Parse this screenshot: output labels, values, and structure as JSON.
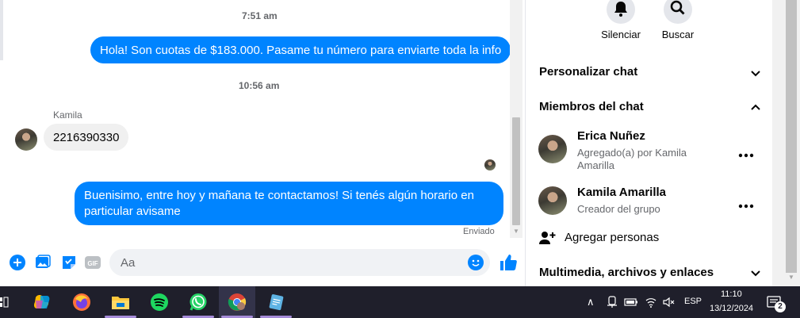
{
  "chat": {
    "timestamp1": "7:51 am",
    "message1": "Hola! Son cuotas de $183.000. Pasame tu número para enviarte toda la info",
    "timestamp2": "10:56 am",
    "sender_name": "Kamila",
    "message2": "2216390330",
    "message3_line1": "Buenisimo, entre hoy y mañana te contactamos! Si tenés algún horario en",
    "message3_line2": "particular avisame",
    "status": "Enviado"
  },
  "composer": {
    "placeholder": "Aa",
    "gif_label": "GIF"
  },
  "panel": {
    "mute_label": "Silenciar",
    "search_label": "Buscar",
    "customize_label": "Personalizar chat",
    "members_label": "Miembros del chat",
    "members": [
      {
        "name": "Erica Nuñez",
        "sub": "Agregado(a) por Kamila Amarilla"
      },
      {
        "name": "Kamila Amarilla",
        "sub": "Creador del grupo"
      }
    ],
    "add_people_label": "Agregar personas",
    "media_label": "Multimedia, archivos y enlaces"
  },
  "taskbar": {
    "language": "ESP",
    "time": "11:10",
    "date": "13/12/2024",
    "notification_count": "2"
  },
  "colors": {
    "messenger_blue": "#0084ff",
    "taskbar_bg": "#1f1f2b"
  }
}
